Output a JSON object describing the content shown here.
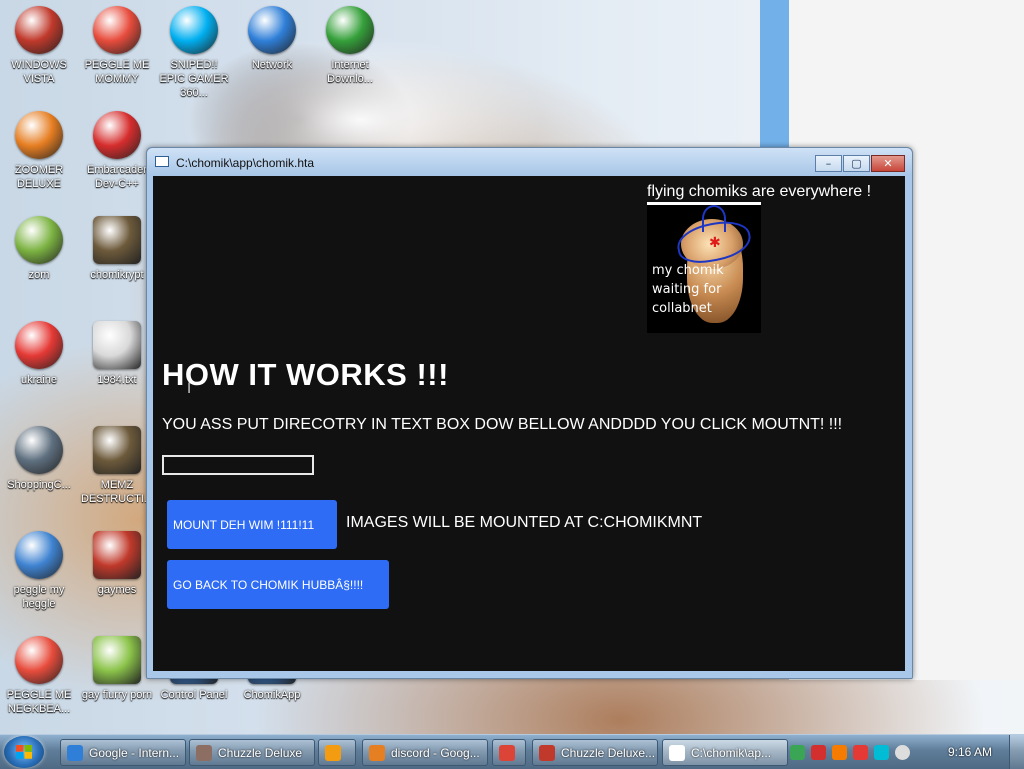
{
  "desktop": {
    "icons": [
      {
        "label": "WINDOWS VISTA",
        "icon": "toilet-icon",
        "color": "#c0392b"
      },
      {
        "label": "PEGGLE ME MOMMY",
        "icon": "peggle-icon",
        "color": "#e74c3c"
      },
      {
        "label": "SNIPED!! EPIC GAMER 360...",
        "icon": "skype-icon",
        "color": "#00aff0"
      },
      {
        "label": "Network",
        "icon": "network-globe-icon",
        "color": "#2f7fd8"
      },
      {
        "label": "Internet Downlo...",
        "icon": "download-globe-icon",
        "color": "#35a03a"
      },
      {
        "label": "ZOOMER DELUXE",
        "icon": "zuma-icon",
        "color": "#e67e22"
      },
      {
        "label": "Embarcader Dev-C++",
        "icon": "devcpp-icon",
        "color": "#d62d2d"
      },
      {
        "label": "zom",
        "icon": "flower-icon",
        "color": "#7cb342"
      },
      {
        "label": "chomikrypt",
        "icon": "clock-doc-icon",
        "color": "#6d5a3b"
      },
      {
        "label": "ukraine",
        "icon": "radiation-icon",
        "color": "#e53935"
      },
      {
        "label": "1984.txt",
        "icon": "text-file-icon",
        "color": "#d9d9d9"
      },
      {
        "label": "ShoppingC...",
        "icon": "flash-icon",
        "color": "#5e6f7f"
      },
      {
        "label": "MEMZ DESTRUCTI...",
        "icon": "clock-doc-icon",
        "color": "#6d5a3b"
      },
      {
        "label": "peggle my heggle",
        "icon": "peggle-icon",
        "color": "#3f83d1"
      },
      {
        "label": "gaymes",
        "icon": "media-folder-icon",
        "color": "#c0392b"
      },
      {
        "label": "PEGGLE ME NEGKBEA...",
        "icon": "peggle-icon",
        "color": "#e74c3c"
      },
      {
        "label": "gay fiurry porn",
        "icon": "hamster-box-icon",
        "color": "#8bc34a"
      },
      {
        "label": "Control Panel",
        "icon": "control-panel-icon",
        "color": "#3b78c2"
      },
      {
        "label": "ChomikApp",
        "icon": "app-icon",
        "color": "#3b78c2"
      }
    ]
  },
  "window": {
    "title": "C:\\chomik\\app\\chomik.hta",
    "minimize": "–",
    "maximize": "▢",
    "close": "✕",
    "fly_caption": "flying chomiks are everywhere !",
    "hamster_caption": "my chomik waiting for collabnet",
    "heading": "HOW IT WORKS !!!",
    "instruction": "YOU ASS PUT DIRECOTRY IN TEXT BOX DOW BELLOW ANDDDD YOU CLICK MOUTNT! !!!",
    "directory_value": "",
    "mount_button": "MOUNT DEH WIM !111!11",
    "mount_note": "IMAGES WILL BE MOUNTED AT C:CHOMIKMNT",
    "back_button": "GO BACK TO CHOMIK HUBBÂ§!!!!",
    "accent": "#2f6cf5"
  },
  "taskbar": {
    "tasks": [
      {
        "label": "Google - Intern...",
        "icon": "ie-icon",
        "color": "#2f7fd8"
      },
      {
        "label": "Chuzzle Deluxe",
        "icon": "chuzzle-icon",
        "color": "#8d6e63"
      },
      {
        "label": "",
        "icon": "media-player-icon",
        "color": "#f39c12"
      },
      {
        "label": "discord - Goog...",
        "icon": "discord-icon",
        "color": "#e67e22"
      },
      {
        "label": "",
        "icon": "chrome-icon",
        "color": "#db4437"
      },
      {
        "label": "Chuzzle Deluxe...",
        "icon": "chuzzle-icon",
        "color": "#c0392b"
      },
      {
        "label": "C:\\chomik\\ap...",
        "icon": "hta-window-icon",
        "color": "#ffffff"
      }
    ],
    "clock": "9:16 AM"
  }
}
